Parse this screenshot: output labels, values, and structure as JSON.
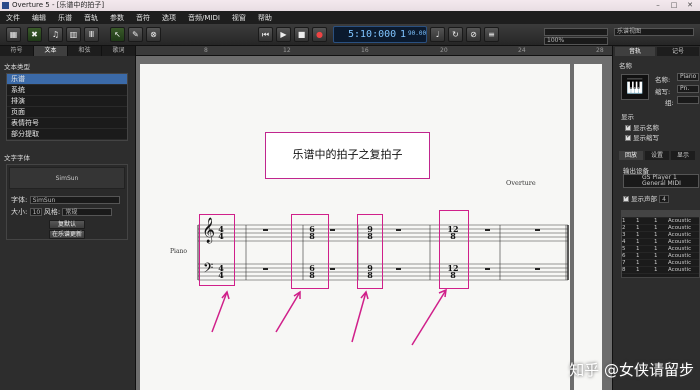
{
  "window": {
    "title": "Overture 5 - [乐谱中的拍子]"
  },
  "menu": [
    "文件",
    "编辑",
    "乐谱",
    "音轨",
    "参数",
    "音符",
    "选项",
    "音频/MIDI",
    "视窗",
    "帮助"
  ],
  "transport": {
    "counter": "5:10:000",
    "track_num": "1",
    "tempo": "90.00"
  },
  "toolbar": {
    "zoom": "100%",
    "view_mode": "乐谱视图"
  },
  "left_panel": {
    "tabs": [
      "符号",
      "文本",
      "和弦",
      "歌词"
    ],
    "text_type_title": "文本类型",
    "text_types": [
      "乐谱",
      "系统",
      "排演",
      "页面",
      "表情符号",
      "部分提取"
    ],
    "text_font_title": "文字字体",
    "font_sample": "SimSun",
    "font_label": "字体:",
    "font_value": "SimSun",
    "size_label": "大小:",
    "size_value": "10",
    "style_label": "风格:",
    "style_value": "常规",
    "default_button": "复默认",
    "apply_button": "在乐谱更新"
  },
  "ruler": [
    "8",
    "12",
    "16",
    "20",
    "24",
    "28"
  ],
  "score": {
    "title": "乐谱中的拍子之复拍子",
    "composer": "Overture",
    "instrument": "Piano",
    "time_signatures": [
      {
        "top": "4",
        "bottom": "4"
      },
      {
        "top": "6",
        "bottom": "8"
      },
      {
        "top": "9",
        "bottom": "8"
      },
      {
        "top": "12",
        "bottom": "8"
      }
    ]
  },
  "right_panel": {
    "tabs": [
      "音轨",
      "记号"
    ],
    "title": "名称",
    "name_label": "名称:",
    "name_value": "Piano",
    "abbr_label": "缩写:",
    "abbr_value": "Pn.",
    "group_label": "组:",
    "show_title": "显示",
    "show_name": "显示名称",
    "show_abbr": "显示缩写",
    "sub_tabs": [
      "回放",
      "设置",
      "显示"
    ],
    "output_label": "输出设备",
    "device_line1": "GS Player 1",
    "device_line2": "General MIDI",
    "show_voices": "显示声部",
    "voices_count": "4",
    "table_rows": [
      {
        "n": "1",
        "a": "1",
        "b": "1",
        "inst": "Acoustic"
      },
      {
        "n": "2",
        "a": "1",
        "b": "1",
        "inst": "Acoustic"
      },
      {
        "n": "3",
        "a": "1",
        "b": "1",
        "inst": "Acoustic"
      },
      {
        "n": "4",
        "a": "1",
        "b": "1",
        "inst": "Acoustic"
      },
      {
        "n": "5",
        "a": "1",
        "b": "1",
        "inst": "Acoustic"
      },
      {
        "n": "6",
        "a": "1",
        "b": "1",
        "inst": "Acoustic"
      },
      {
        "n": "7",
        "a": "1",
        "b": "1",
        "inst": "Acoustic"
      },
      {
        "n": "8",
        "a": "1",
        "b": "1",
        "inst": "Acoustic"
      }
    ]
  },
  "watermark": "知乎 @女侠请留步",
  "colors": {
    "highlight": "#d0208a",
    "selection": "#3b6aa8",
    "lcd": "#7fc4ff"
  }
}
